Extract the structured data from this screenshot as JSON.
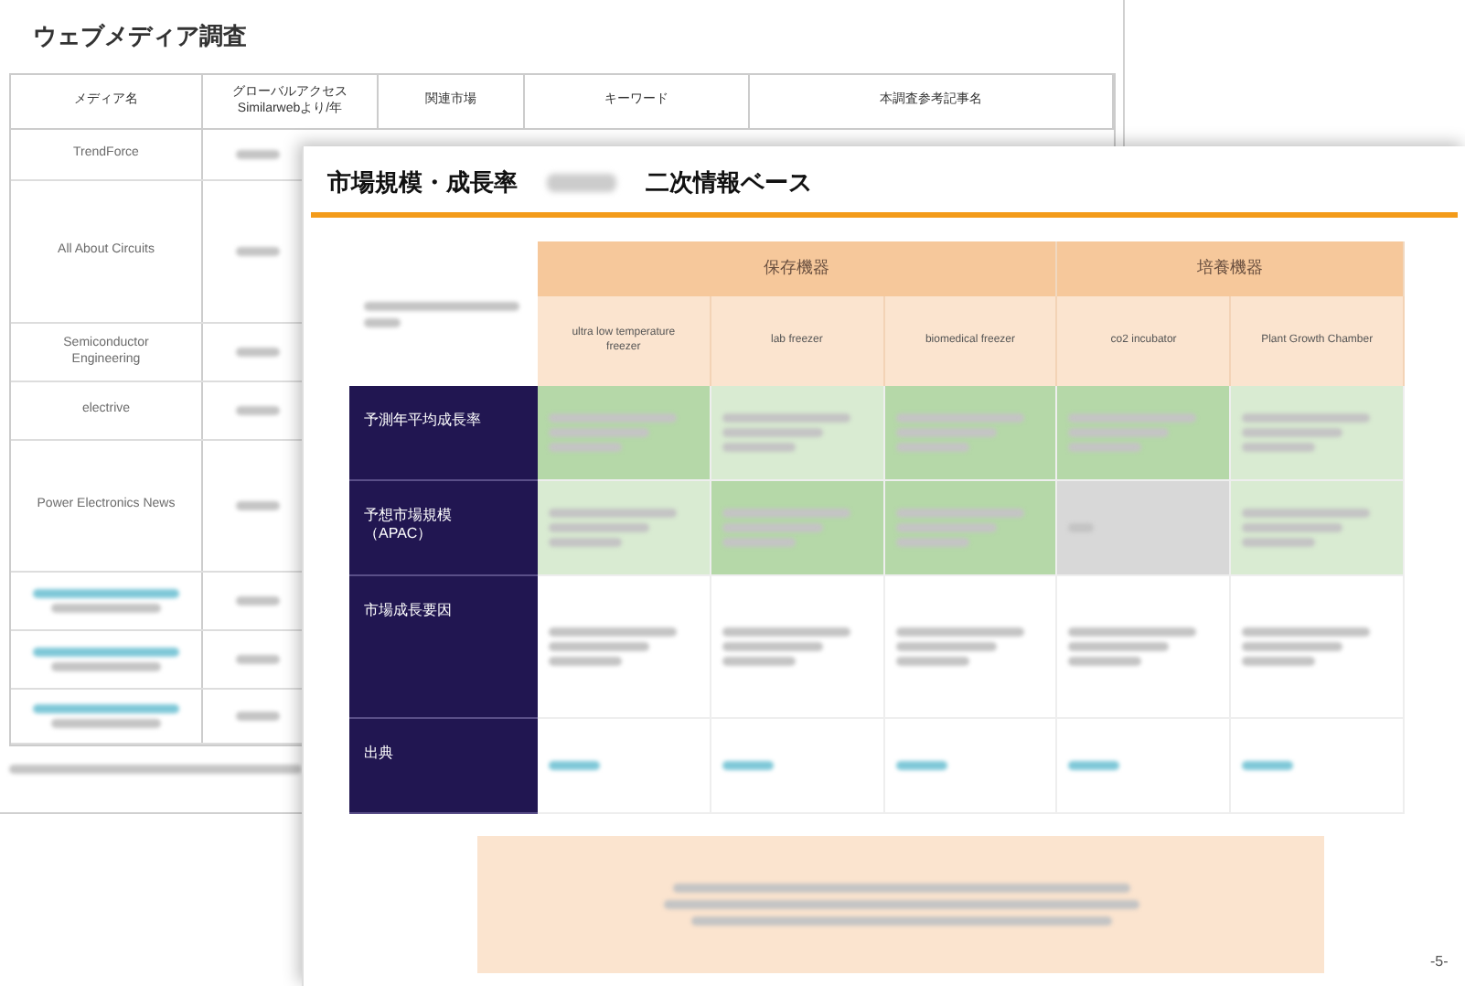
{
  "back_slide": {
    "title": "ウェブメディア調査",
    "columns": [
      "メディア名",
      "グローバルアクセス\nSimilarwebより/年",
      "関連市場",
      "キーワード",
      "本調査参考記事名"
    ],
    "rows": [
      {
        "name": "TrendForce",
        "kind": "plain"
      },
      {
        "name": "All About Circuits",
        "kind": "plain"
      },
      {
        "name": "Semiconductor\nEngineering",
        "kind": "plain"
      },
      {
        "name": "electrive",
        "kind": "plain"
      },
      {
        "name": "Power Electronics News",
        "kind": "plain"
      },
      {
        "kind": "link"
      },
      {
        "kind": "link"
      },
      {
        "kind": "link"
      }
    ]
  },
  "front_slide": {
    "title": "市場規模・成長率",
    "subtitle": "二次情報ベース",
    "page": "-5-",
    "groups": [
      "保存機器",
      "培養機器"
    ],
    "columns": [
      "ultra low temperature\nfreezer",
      "lab freezer",
      "biomedical freezer",
      "co2 incubator",
      "Plant Growth Chamber"
    ],
    "rows": [
      {
        "label": "予測年平均成長率",
        "cells": [
          {
            "kind": "value",
            "highlighted": true
          },
          {
            "kind": "value",
            "highlighted": false
          },
          {
            "kind": "value",
            "highlighted": true
          },
          {
            "kind": "value",
            "highlighted": true
          },
          {
            "kind": "value",
            "highlighted": false
          }
        ]
      },
      {
        "label": "予想市場規模",
        "note": "（APAC）",
        "cells": [
          {
            "kind": "value",
            "highlighted": false
          },
          {
            "kind": "value",
            "highlighted": true
          },
          {
            "kind": "value",
            "highlighted": true
          },
          {
            "kind": "na",
            "highlighted": false
          },
          {
            "kind": "value",
            "highlighted": false
          }
        ]
      },
      {
        "label": "市場成長要因",
        "cells": [
          {
            "kind": "text",
            "highlighted": false
          },
          {
            "kind": "text",
            "highlighted": false
          },
          {
            "kind": "text",
            "highlighted": false
          },
          {
            "kind": "text",
            "highlighted": false
          },
          {
            "kind": "text",
            "highlighted": false
          }
        ]
      },
      {
        "label": "出典",
        "cells": [
          {
            "kind": "link",
            "highlighted": false
          },
          {
            "kind": "link",
            "highlighted": false
          },
          {
            "kind": "link",
            "highlighted": false
          },
          {
            "kind": "link",
            "highlighted": false
          },
          {
            "kind": "link",
            "highlighted": false
          }
        ]
      }
    ]
  }
}
